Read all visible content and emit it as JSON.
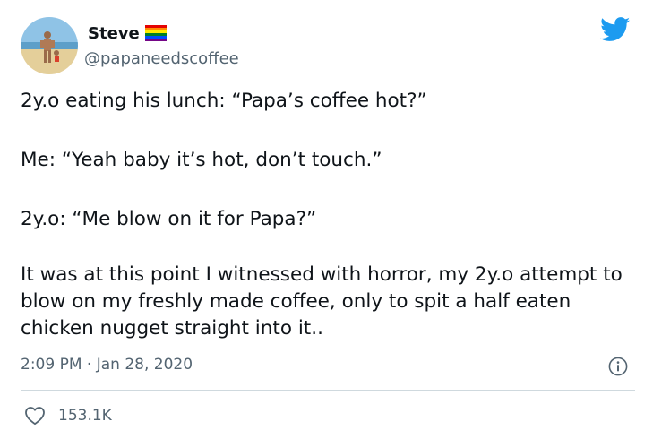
{
  "author": {
    "display_name": "Steve",
    "handle": "@papaneedscoffee",
    "badge_icon": "rainbow-flag-icon",
    "rainbow_colors": [
      "#e40303",
      "#ff8c00",
      "#ffed00",
      "#008026",
      "#004dff",
      "#750787"
    ]
  },
  "tweet": {
    "paragraphs": [
      "2y.o eating his lunch: “Papa’s coffee hot?”",
      "Me: “Yeah baby it’s hot, don’t touch.”",
      "2y.o: “Me blow on it for Papa?”",
      "It was at this point I witnessed with horror, my 2y.o attempt to blow on my freshly made coffee, only to spit a half eaten chicken nugget straight into it.."
    ],
    "timestamp": "2:09 PM · Jan 28, 2020"
  },
  "engagement": {
    "likes": "153.1K"
  },
  "icons": {
    "brand": "twitter-bird-icon",
    "info": "info-icon",
    "like": "heart-icon"
  },
  "colors": {
    "twitter_blue": "#1d9bf0",
    "secondary_text": "#536471",
    "divider": "#cfd9de"
  }
}
